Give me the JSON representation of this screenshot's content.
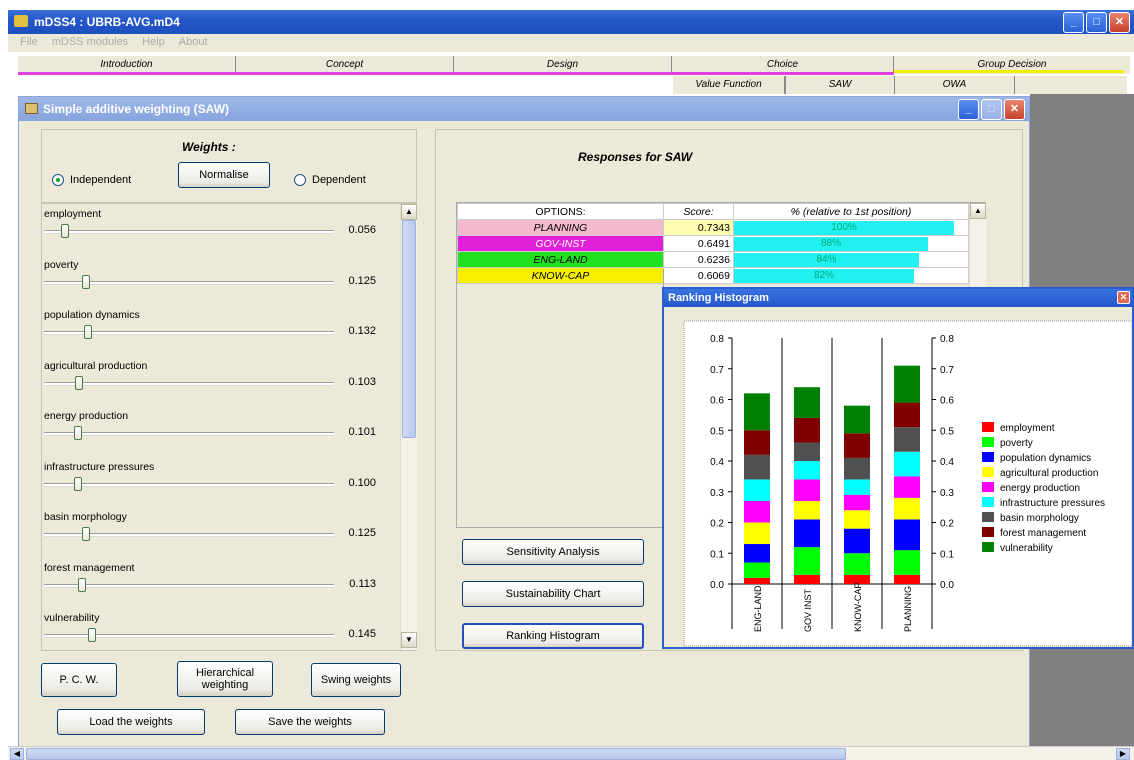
{
  "outer_window": {
    "title": "mDSS4 : UBRB-AVG.mD4"
  },
  "menu": [
    "File",
    "mDSS modules",
    "Help",
    "About"
  ],
  "main_tabs": [
    "Introduction",
    "Concept",
    "Design",
    "Choice",
    "Group Decision"
  ],
  "sub_tabs": [
    "Value Function",
    "SAW",
    "OWA"
  ],
  "saw_window": {
    "title": "Simple additive weighting (SAW)"
  },
  "weights": {
    "heading": "Weights :",
    "independent_label": "Independent",
    "dependent_label": "Dependent",
    "normalise_label": "Normalise",
    "mode": "Independent",
    "criteria": [
      {
        "label": "employment",
        "value": "0.056",
        "level": 0.056
      },
      {
        "label": "poverty",
        "value": "0.125",
        "level": 0.125
      },
      {
        "label": "population dynamics",
        "value": "0.132",
        "level": 0.132
      },
      {
        "label": "agricultural production",
        "value": "0.103",
        "level": 0.103
      },
      {
        "label": "energy production",
        "value": "0.101",
        "level": 0.101
      },
      {
        "label": "infrastructure pressures",
        "value": "0.100",
        "level": 0.1
      },
      {
        "label": "basin morphology",
        "value": "0.125",
        "level": 0.125
      },
      {
        "label": "forest management",
        "value": "0.113",
        "level": 0.113
      },
      {
        "label": "vulnerability",
        "value": "0.145",
        "level": 0.145
      }
    ]
  },
  "buttons": {
    "pcw": "P. C. W.",
    "hierarchical": "Hierarchical weighting",
    "swing": "Swing weights",
    "load": "Load the weights",
    "save": "Save the weights",
    "sensitivity": "Sensitivity Analysis",
    "sustainability": "Sustainability Chart",
    "ranking": "Ranking Histogram"
  },
  "responses": {
    "heading": "Responses for SAW",
    "col_options": "OPTIONS:",
    "col_score": "Score:",
    "col_percent": "% (relative to 1st position)",
    "rows": [
      {
        "option": "PLANNING",
        "score": "0.7343",
        "percent": "100%",
        "pct_value": 1.0,
        "color": "#f4b8cf"
      },
      {
        "option": "GOV-INST",
        "score": "0.6491",
        "percent": "88%",
        "pct_value": 0.88,
        "color": "#e020d8"
      },
      {
        "option": "ENG-LAND",
        "score": "0.6236",
        "percent": "84%",
        "pct_value": 0.84,
        "color": "#20e020"
      },
      {
        "option": "KNOW-CAP",
        "score": "0.6069",
        "percent": "82%",
        "pct_value": 0.82,
        "color": "#f8f000"
      }
    ]
  },
  "histogram_window": {
    "title": "Ranking Histogram"
  },
  "chart_data": {
    "type": "bar",
    "stacked": true,
    "categories": [
      "ENG-LAND",
      "GOV INST",
      "KNOW-CAP",
      "PLANNING"
    ],
    "ylim": [
      0,
      0.8
    ],
    "yticks": [
      "0.0",
      "0.1",
      "0.2",
      "0.3",
      "0.4",
      "0.5",
      "0.6",
      "0.7",
      "0.8"
    ],
    "legend_position": "right",
    "series": [
      {
        "name": "employment",
        "color": "#ff0000",
        "values": [
          0.02,
          0.03,
          0.03,
          0.03
        ]
      },
      {
        "name": "poverty",
        "color": "#00ff00",
        "values": [
          0.05,
          0.09,
          0.07,
          0.08
        ]
      },
      {
        "name": "population dynamics",
        "color": "#0000ff",
        "values": [
          0.06,
          0.09,
          0.08,
          0.1
        ]
      },
      {
        "name": "agricultural production",
        "color": "#ffff00",
        "values": [
          0.07,
          0.06,
          0.06,
          0.07
        ]
      },
      {
        "name": "energy production",
        "color": "#ff00ff",
        "values": [
          0.07,
          0.07,
          0.05,
          0.07
        ]
      },
      {
        "name": "infrastructure pressures",
        "color": "#00ffff",
        "values": [
          0.07,
          0.06,
          0.05,
          0.08
        ]
      },
      {
        "name": "basin morphology",
        "color": "#505050",
        "values": [
          0.08,
          0.06,
          0.07,
          0.08
        ]
      },
      {
        "name": "forest management",
        "color": "#800000",
        "values": [
          0.08,
          0.08,
          0.08,
          0.08
        ]
      },
      {
        "name": "vulnerability",
        "color": "#008000",
        "values": [
          0.12,
          0.1,
          0.09,
          0.12
        ]
      }
    ]
  }
}
